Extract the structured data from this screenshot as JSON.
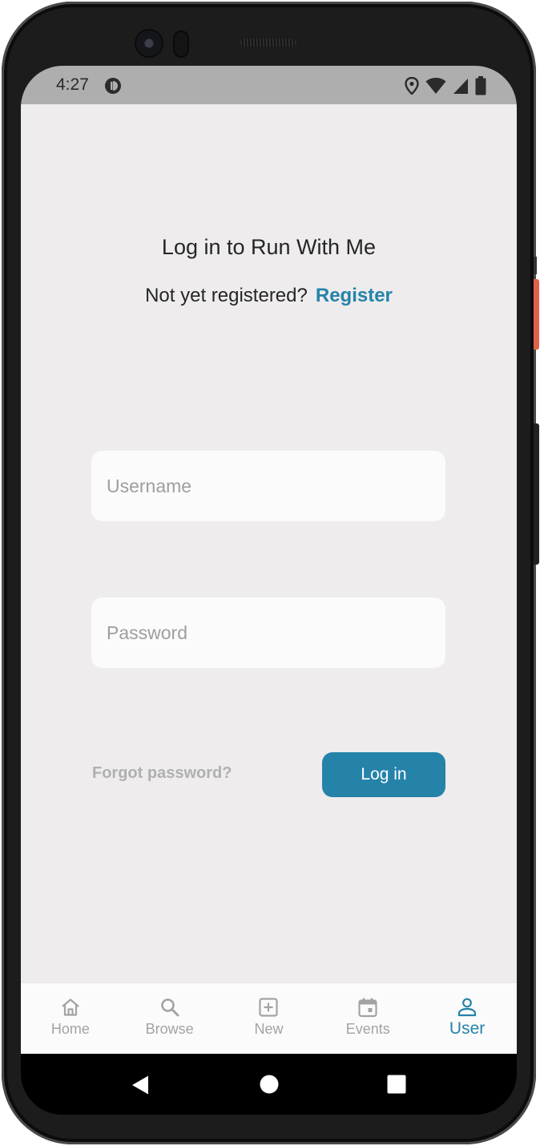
{
  "status_bar": {
    "time": "4:27",
    "icons": [
      "app-notification-icon",
      "location-icon",
      "wifi-icon",
      "signal-icon",
      "battery-icon"
    ]
  },
  "login": {
    "title": "Log in to Run With Me",
    "register_prompt": "Not yet registered?",
    "register_link": "Register",
    "username_placeholder": "Username",
    "password_placeholder": "Password",
    "forgot_password": "Forgot password?",
    "login_button": "Log in"
  },
  "bottom_nav": {
    "items": [
      {
        "label": "Home",
        "icon": "home-icon",
        "active": false
      },
      {
        "label": "Browse",
        "icon": "search-icon",
        "active": false
      },
      {
        "label": "New",
        "icon": "add-box-icon",
        "active": false
      },
      {
        "label": "Events",
        "icon": "calendar-icon",
        "active": false
      },
      {
        "label": "User",
        "icon": "user-icon",
        "active": true
      }
    ]
  },
  "system_nav": [
    "back-icon",
    "home-circle-icon",
    "recents-icon"
  ],
  "colors": {
    "accent": "#2583aa",
    "background": "#eeeced",
    "field": "#fbfbfb",
    "muted_text": "#a3a3a3"
  }
}
